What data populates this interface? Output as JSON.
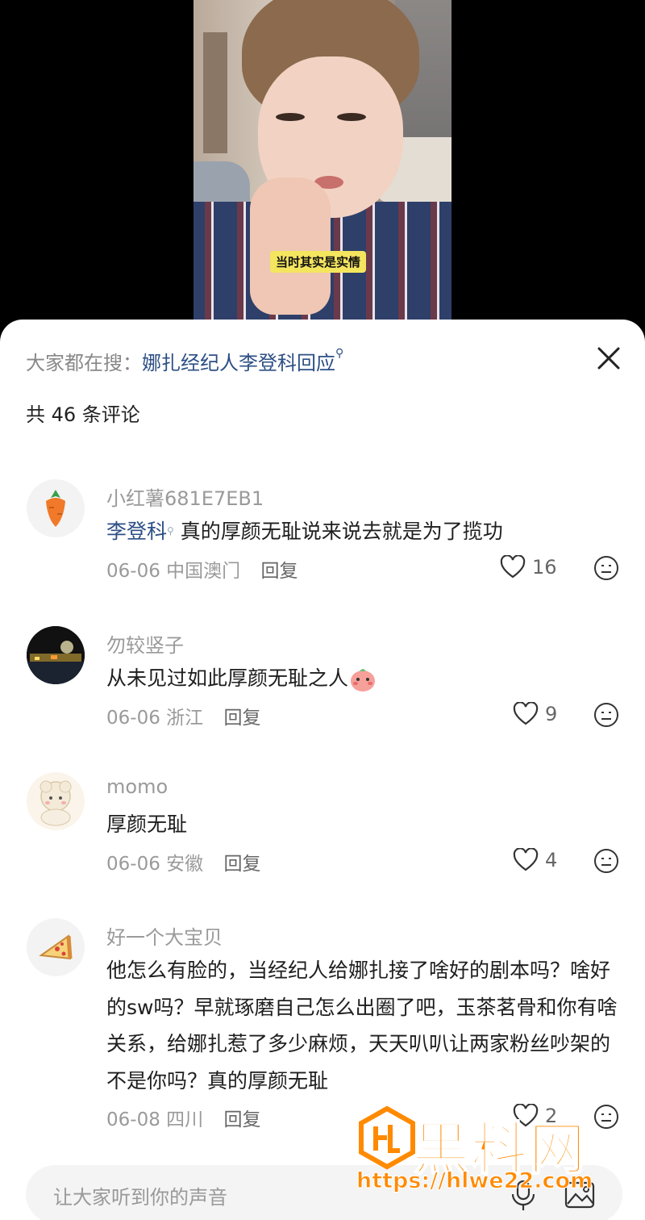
{
  "video": {
    "caption": "当时其实是实情"
  },
  "header": {
    "search_prefix": "大家都在搜：",
    "search_term": "娜扎经纪人李登科回应",
    "comment_count": "共 46 条评论"
  },
  "comments": [
    {
      "username": "小红薯681E7EB1",
      "mention": "李登科",
      "text": " 真的厚颜无耻说来说去就是为了揽功",
      "date": "06-06",
      "location": "中国澳门",
      "reply": "回复",
      "likes": "16",
      "avatar_icon": "carrot-icon"
    },
    {
      "username": "勿较竖子",
      "mention": "",
      "text": "从未见过如此厚颜无耻之人",
      "date": "06-06",
      "location": "浙江",
      "reply": "回复",
      "likes": "9",
      "avatar_icon": "night-city-avatar"
    },
    {
      "username": "momo",
      "mention": "",
      "text": "厚颜无耻",
      "date": "06-06",
      "location": "安徽",
      "reply": "回复",
      "likes": "4",
      "avatar_icon": "sheep-avatar"
    },
    {
      "username": "好一个大宝贝",
      "mention": "",
      "text": "他怎么有脸的，当经纪人给娜扎接了啥好的剧本吗？啥好的sw吗？早就琢磨自己怎么出圈了吧，玉茶茗骨和你有啥关系，给娜扎惹了多少麻烦，天天叭叭让两家粉丝吵架的不是你吗？真的厚颜无耻",
      "date": "06-08",
      "location": "四川",
      "reply": "回复",
      "likes": "2",
      "avatar_icon": "pizza-icon"
    }
  ],
  "input": {
    "placeholder": "让大家听到你的声音"
  },
  "watermark": {
    "brand": "黑料网",
    "url": "https://hlwe22.com"
  },
  "colors": {
    "accent_link": "#2d4f86",
    "watermark": "#ff8a00",
    "caption_bg": "#f4e55e"
  }
}
